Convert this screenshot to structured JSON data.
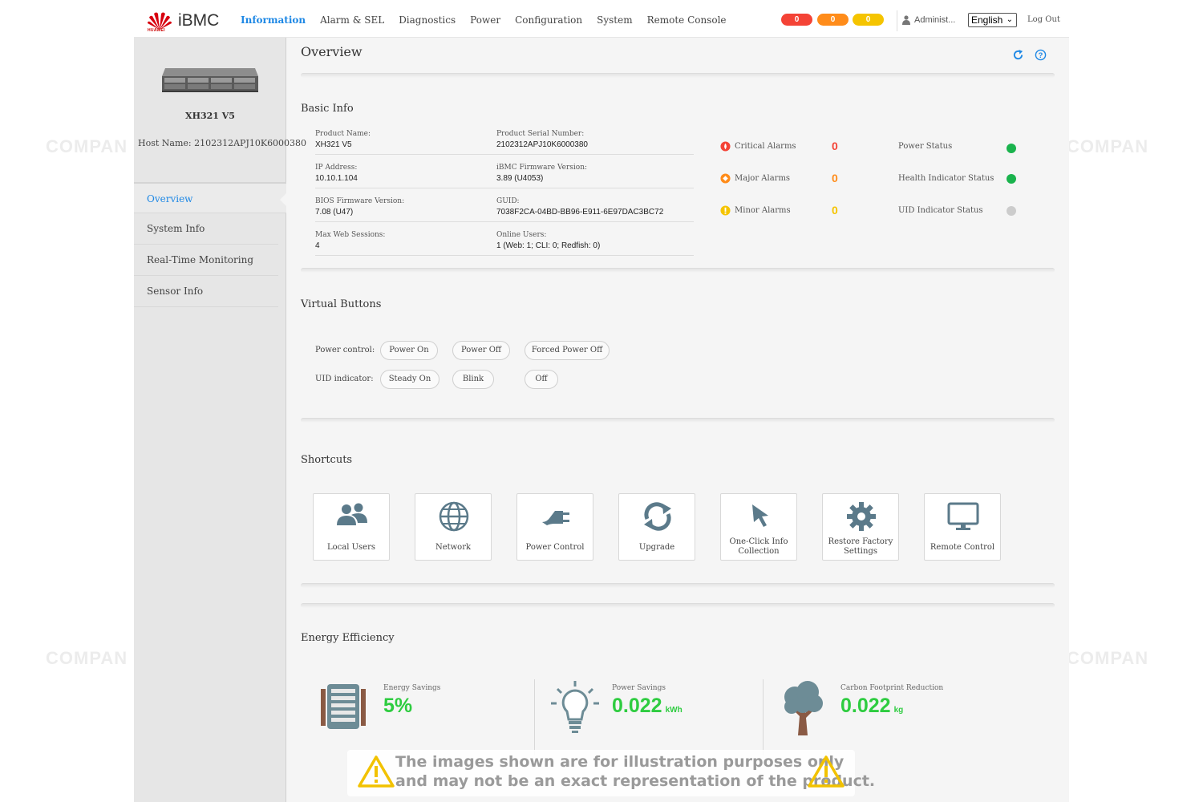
{
  "brand": {
    "name": "iBMC",
    "logo_sub": "HUAWEI",
    "accent": "#1e88e5"
  },
  "nav": [
    "Information",
    "Alarm & SEL",
    "Diagnostics",
    "Power",
    "Configuration",
    "System",
    "Remote Console"
  ],
  "header": {
    "critical_count": "0",
    "major_count": "0",
    "minor_count": "0",
    "user": "Administ...",
    "language": "English",
    "logout": "Log Out"
  },
  "sidebar": {
    "model": "XH321 V5",
    "host_name": "Host Name: 2102312APJ10K6000380",
    "items": [
      "Overview",
      "System Info",
      "Real-Time Monitoring",
      "Sensor Info"
    ]
  },
  "page_title": "Overview",
  "basic_info": {
    "title": "Basic Info",
    "fields": [
      {
        "label": "Product Name:",
        "value": "XH321 V5"
      },
      {
        "label": "Product Serial Number:",
        "value": "2102312APJ10K6000380"
      },
      {
        "label": "IP Address:",
        "value": "10.10.1.104"
      },
      {
        "label": "iBMC Firmware Version:",
        "value": "3.89 (U4053)"
      },
      {
        "label": "BIOS Firmware Version:",
        "value": "7.08 (U47)"
      },
      {
        "label": "GUID:",
        "value": "7038F2CA-04BD-BB96-E911-6E97DAC3BC72"
      },
      {
        "label": "Max Web Sessions:",
        "value": "4"
      },
      {
        "label": "Online Users:",
        "value": "1 (Web: 1; CLI: 0; Redfish: 0)"
      }
    ],
    "alarms": [
      {
        "label": "Critical Alarms",
        "count": "0",
        "color": "#f44336"
      },
      {
        "label": "Major Alarms",
        "count": "0",
        "color": "#ff8c1a"
      },
      {
        "label": "Minor Alarms",
        "count": "0",
        "color": "#f5c400"
      }
    ],
    "statuses": [
      {
        "label": "Power Status",
        "color": "#1ab34d"
      },
      {
        "label": "Health Indicator Status",
        "color": "#1ab34d"
      },
      {
        "label": "UID Indicator Status",
        "color": "#cccccc"
      }
    ]
  },
  "virtual_buttons": {
    "title": "Virtual Buttons",
    "power_label": "Power control:",
    "power_buttons": [
      "Power On",
      "Power Off",
      "Forced Power Off"
    ],
    "uid_label": "UID indicator:",
    "uid_buttons": [
      "Steady On",
      "Blink",
      "Off"
    ]
  },
  "shortcuts": {
    "title": "Shortcuts",
    "items": [
      {
        "label": "Local Users",
        "icon": "users-icon"
      },
      {
        "label": "Network",
        "icon": "globe-icon"
      },
      {
        "label": "Power Control",
        "icon": "plug-icon"
      },
      {
        "label": "Upgrade",
        "icon": "sync-icon"
      },
      {
        "label": "One-Click Info Collection",
        "icon": "cursor-icon"
      },
      {
        "label": "Restore Factory Settings",
        "icon": "gear-icon"
      },
      {
        "label": "Remote Control",
        "icon": "monitor-icon"
      }
    ]
  },
  "energy": {
    "title": "Energy Efficiency",
    "items": [
      {
        "label": "Energy Savings",
        "value": "5%",
        "unit": ""
      },
      {
        "label": "Power Savings",
        "value": "0.022",
        "unit": "kWh"
      },
      {
        "label": "Carbon Footprint Reduction",
        "value": "0.022",
        "unit": "kg"
      }
    ]
  },
  "disclaimer": {
    "line1": "The images shown are for illustration purposes only",
    "line2": "and may not be an exact representation of the product."
  },
  "watermark": "COMPAN"
}
